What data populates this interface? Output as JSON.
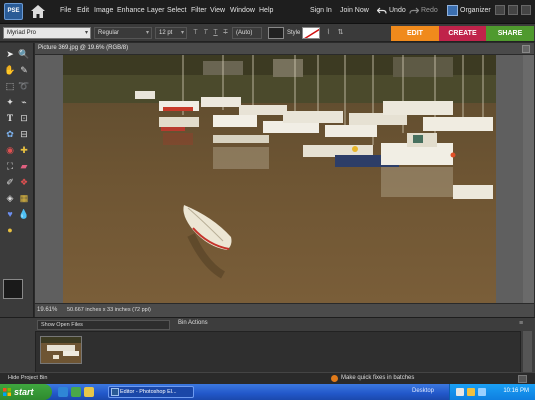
{
  "menubar": {
    "logo_text": "PSE",
    "items": [
      "File",
      "Edit",
      "Image",
      "Enhance",
      "Layer",
      "Select",
      "Filter",
      "View",
      "Window",
      "Help"
    ],
    "sign_in": "Sign In",
    "join_now": "Join Now",
    "undo": "Undo",
    "redo": "Redo",
    "organizer": "Organizer"
  },
  "options": {
    "font_family": "Myriad Pro",
    "font_style": "Regular",
    "font_size": "12 pt",
    "leading": "(Auto)",
    "style_label": "Style"
  },
  "mode_tabs": [
    {
      "label": "EDIT",
      "color": "#f08a1c"
    },
    {
      "label": "CREATE",
      "color": "#c0234a"
    },
    {
      "label": "SHARE",
      "color": "#4f9a2e"
    }
  ],
  "document": {
    "title": "Picture 369.jpg @ 19.6% (RGB/8)",
    "zoom": "19.61%",
    "size": "50.667 inches x 33 inches (72 ppi)"
  },
  "bin": {
    "show_select": "Show Open Files",
    "actions": "Bin Actions"
  },
  "bottombar": {
    "hide_bin": "Hide Project Bin",
    "quickfix": "Make quick fixes in batches"
  },
  "taskbar": {
    "start": "start",
    "task": "Editor - Photoshop El...",
    "desktop": "Desktop",
    "clock": "10:16 PM"
  },
  "colors": {
    "edit_tab": "#f08a1c",
    "create_tab": "#c0234a",
    "share_tab": "#4f9a2e",
    "taskbar": "#2257c9"
  }
}
